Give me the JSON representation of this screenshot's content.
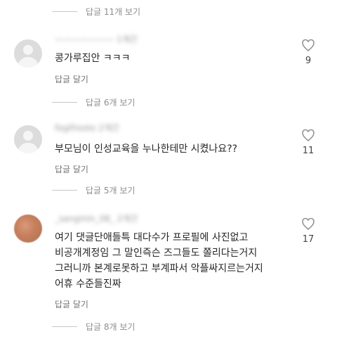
{
  "threads": [
    {
      "replies_label": "답글 11개 보기"
    },
    {
      "username": "——————— 1개간",
      "text": [
        "콩가루집안 ㅋㅋㅋ"
      ],
      "reply_label": "답글 달기",
      "likes": "9",
      "replies_label": "답글 6개 보기"
    },
    {
      "username": "fogifrooto 2개간",
      "text": [
        "부모님이 인성교육을 누나한테만 시켰나요??"
      ],
      "reply_label": "답글 달기",
      "likes": "11",
      "replies_label": "답글 5개 보기"
    },
    {
      "username": "_sangmin_08_ 2개간",
      "text": [
        "여기 댓글단애들특 대다수가 프로필에 사진없고",
        "비공개계정임 그 말인즉슨 즈그들도 쫄리다는거지",
        "그러니까 본계로못하고 부계파서 악플싸지르는거지",
        "어휴 수준들진짜"
      ],
      "reply_label": "답글 달기",
      "likes": "17",
      "replies_label": "답글 8개 보기"
    }
  ]
}
